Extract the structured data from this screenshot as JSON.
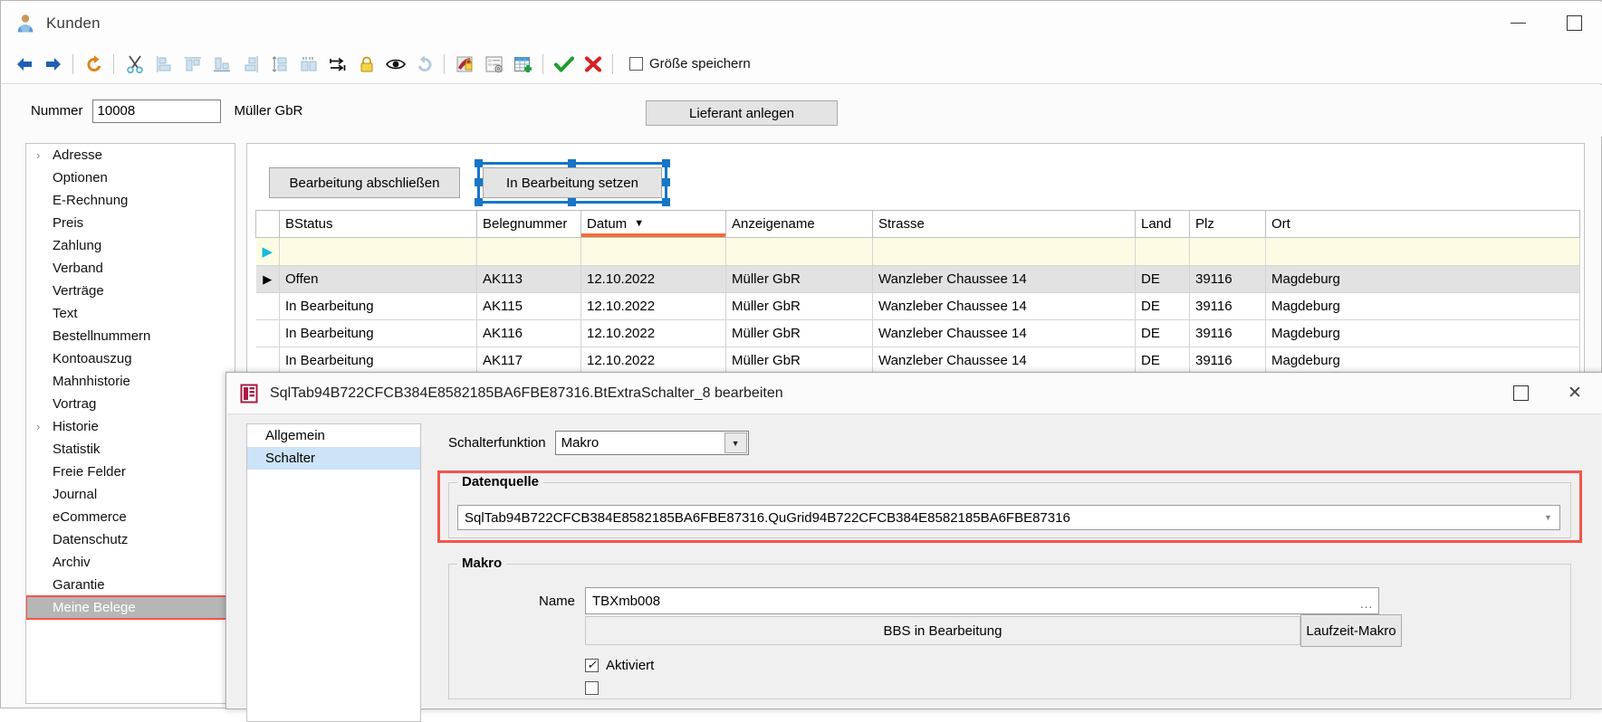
{
  "window": {
    "title": "Kunden",
    "icon": "user-icon",
    "minimize_label": "Minimieren",
    "maximize_label": "Maximieren"
  },
  "toolbar": {
    "buttons": [
      {
        "name": "back-icon",
        "title": "Zurück"
      },
      {
        "name": "forward-icon",
        "title": "Vor"
      },
      {
        "name": "undo-icon",
        "title": "Rückgängig"
      },
      {
        "name": "cut-icon",
        "title": "Ausschneiden"
      },
      {
        "name": "align-left-icon",
        "title": "Links ausrichten"
      },
      {
        "name": "align-top-icon",
        "title": "Oben ausrichten"
      },
      {
        "name": "align-bottom-icon",
        "title": "Unten ausrichten"
      },
      {
        "name": "align-right-icon",
        "title": "Rechts ausrichten"
      },
      {
        "name": "distribute-vertical-icon",
        "title": "Vertikal verteilen"
      },
      {
        "name": "distribute-horizontal-icon",
        "title": "Horizontal verteilen"
      },
      {
        "name": "tab-order-icon",
        "title": "Tab-Reihenfolge"
      },
      {
        "name": "lock-icon",
        "title": "Sperren"
      },
      {
        "name": "eye-icon",
        "title": "Vorschau"
      },
      {
        "name": "redo-icon",
        "title": "Wiederherstellen"
      },
      {
        "name": "design-lock-icon",
        "title": "Designsperre"
      },
      {
        "name": "form-settings-icon",
        "title": "Formular-Einstellungen"
      },
      {
        "name": "add-table-icon",
        "title": "Tabelle hinzufügen"
      },
      {
        "name": "ok-check-icon",
        "title": "Übernehmen"
      },
      {
        "name": "cancel-x-icon",
        "title": "Abbrechen"
      }
    ],
    "checkbox": {
      "label": "Größe speichern",
      "checked": false
    }
  },
  "header": {
    "nummer_label": "Nummer",
    "nummer_value": "10008",
    "kunde_name": "Müller GbR",
    "lieferant_button": "Lieferant anlegen"
  },
  "tree": {
    "items": [
      {
        "label": "Adresse",
        "expandable": true,
        "selected": false
      },
      {
        "label": "Optionen",
        "expandable": false,
        "selected": false
      },
      {
        "label": "E-Rechnung",
        "expandable": false,
        "selected": false
      },
      {
        "label": "Preis",
        "expandable": false,
        "selected": false
      },
      {
        "label": "Zahlung",
        "expandable": false,
        "selected": false
      },
      {
        "label": "Verband",
        "expandable": false,
        "selected": false
      },
      {
        "label": "Verträge",
        "expandable": false,
        "selected": false
      },
      {
        "label": "Text",
        "expandable": false,
        "selected": false
      },
      {
        "label": "Bestellnummern",
        "expandable": false,
        "selected": false
      },
      {
        "label": "Kontoauszug",
        "expandable": false,
        "selected": false
      },
      {
        "label": "Mahnhistorie",
        "expandable": false,
        "selected": false
      },
      {
        "label": "Vortrag",
        "expandable": false,
        "selected": false
      },
      {
        "label": "Historie",
        "expandable": true,
        "selected": false
      },
      {
        "label": "Statistik",
        "expandable": false,
        "selected": false
      },
      {
        "label": "Freie Felder",
        "expandable": false,
        "selected": false
      },
      {
        "label": "Journal",
        "expandable": false,
        "selected": false
      },
      {
        "label": "eCommerce",
        "expandable": false,
        "selected": false
      },
      {
        "label": "Datenschutz",
        "expandable": false,
        "selected": false
      },
      {
        "label": "Archiv",
        "expandable": false,
        "selected": false
      },
      {
        "label": "Garantie",
        "expandable": false,
        "selected": false
      },
      {
        "label": "Meine Belege",
        "expandable": false,
        "selected": true
      }
    ]
  },
  "grid_panel": {
    "buttons": {
      "abschliessen": "Bearbeitung abschließen",
      "in_bearbeitung": "In Bearbeitung setzen"
    },
    "table": {
      "columns": [
        "BStatus",
        "Belegnummer",
        "Datum",
        "Anzeigename",
        "Strasse",
        "Land",
        "Plz",
        "Ort"
      ],
      "sorted_column": "Datum",
      "sort_direction": "desc",
      "rows": [
        {
          "selector": "new",
          "BStatus": "",
          "Belegnummer": "",
          "Datum": "",
          "Anzeigename": "",
          "Strasse": "",
          "Land": "",
          "Plz": "",
          "Ort": ""
        },
        {
          "selector": "current",
          "BStatus": "Offen",
          "Belegnummer": "AK113",
          "Datum": "12.10.2022",
          "Anzeigename": "Müller GbR",
          "Strasse": "Wanzleber Chaussee 14",
          "Land": "DE",
          "Plz": "39116",
          "Ort": "Magdeburg"
        },
        {
          "selector": "",
          "BStatus": "In Bearbeitung",
          "Belegnummer": "AK115",
          "Datum": "12.10.2022",
          "Anzeigename": "Müller GbR",
          "Strasse": "Wanzleber Chaussee 14",
          "Land": "DE",
          "Plz": "39116",
          "Ort": "Magdeburg"
        },
        {
          "selector": "",
          "BStatus": "In Bearbeitung",
          "Belegnummer": "AK116",
          "Datum": "12.10.2022",
          "Anzeigename": "Müller GbR",
          "Strasse": "Wanzleber Chaussee 14",
          "Land": "DE",
          "Plz": "39116",
          "Ort": "Magdeburg"
        },
        {
          "selector": "",
          "BStatus": "In Bearbeitung",
          "Belegnummer": "AK117",
          "Datum": "12.10.2022",
          "Anzeigename": "Müller GbR",
          "Strasse": "Wanzleber Chaussee 14",
          "Land": "DE",
          "Plz": "39116",
          "Ort": "Magdeburg"
        }
      ]
    }
  },
  "dialog": {
    "title": "SqlTab94B722CFCB384E8582185BA6FBE87316.BtExtraSchalter_8 bearbeiten",
    "icon": "form-editor-icon",
    "maximize_label": "Maximieren",
    "close_label": "Schließen",
    "nav": [
      {
        "label": "Allgemein",
        "active": false
      },
      {
        "label": "Schalter",
        "active": true
      }
    ],
    "schalterfunktion": {
      "label": "Schalterfunktion",
      "value": "Makro"
    },
    "datenquelle": {
      "legend": "Datenquelle",
      "value": "SqlTab94B722CFCB384E8582185BA6FBE87316.QuGrid94B722CFCB384E8582185BA6FBE87316",
      "highlight_color": "#f4544a"
    },
    "makro": {
      "legend": "Makro",
      "name_label": "Name",
      "name_value": "TBXmb008",
      "browse_label": "...",
      "bbs_text": "BBS in Bearbeitung",
      "laufzeit_button": "Laufzeit-Makro",
      "aktiviert_label": "Aktiviert",
      "aktiviert_checked": true,
      "second_checkbox_checked": false
    }
  },
  "colors": {
    "selection_blue": "#1675c8",
    "sort_orange": "#f0703c",
    "highlight_red": "#f4544a",
    "nav_active": "#cde3f7"
  }
}
